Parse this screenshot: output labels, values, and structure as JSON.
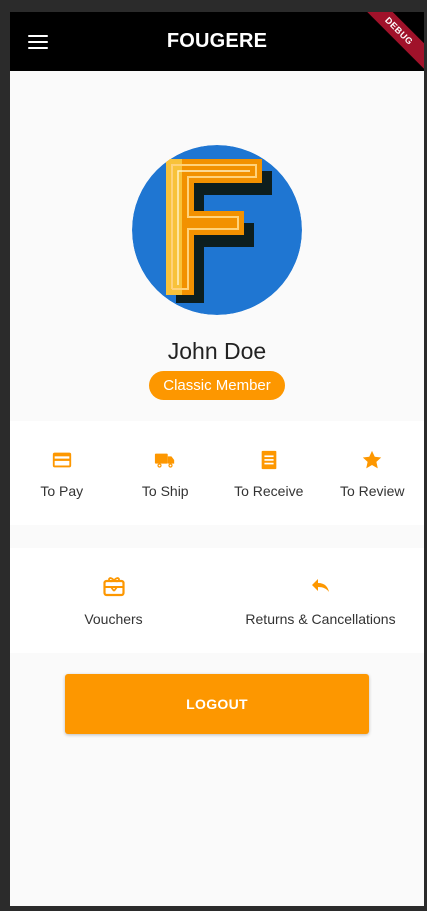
{
  "app": {
    "title": "FOUGERE",
    "debug_label": "DEBUG"
  },
  "profile": {
    "name": "John Doe",
    "membership": "Classic Member",
    "avatar_letter": "F"
  },
  "orders": [
    {
      "label": "To Pay",
      "icon": "credit-card-icon"
    },
    {
      "label": "To Ship",
      "icon": "truck-icon"
    },
    {
      "label": "To Receive",
      "icon": "receipt-icon"
    },
    {
      "label": "To Review",
      "icon": "star-icon"
    }
  ],
  "services": [
    {
      "label": "Vouchers",
      "icon": "gift-card-icon"
    },
    {
      "label": "Returns & Cancellations",
      "icon": "undo-icon"
    }
  ],
  "actions": {
    "logout_label": "LOGOUT"
  },
  "colors": {
    "accent": "#fd9700",
    "appbar": "#000000",
    "avatar_bg": "#1f76d2"
  }
}
